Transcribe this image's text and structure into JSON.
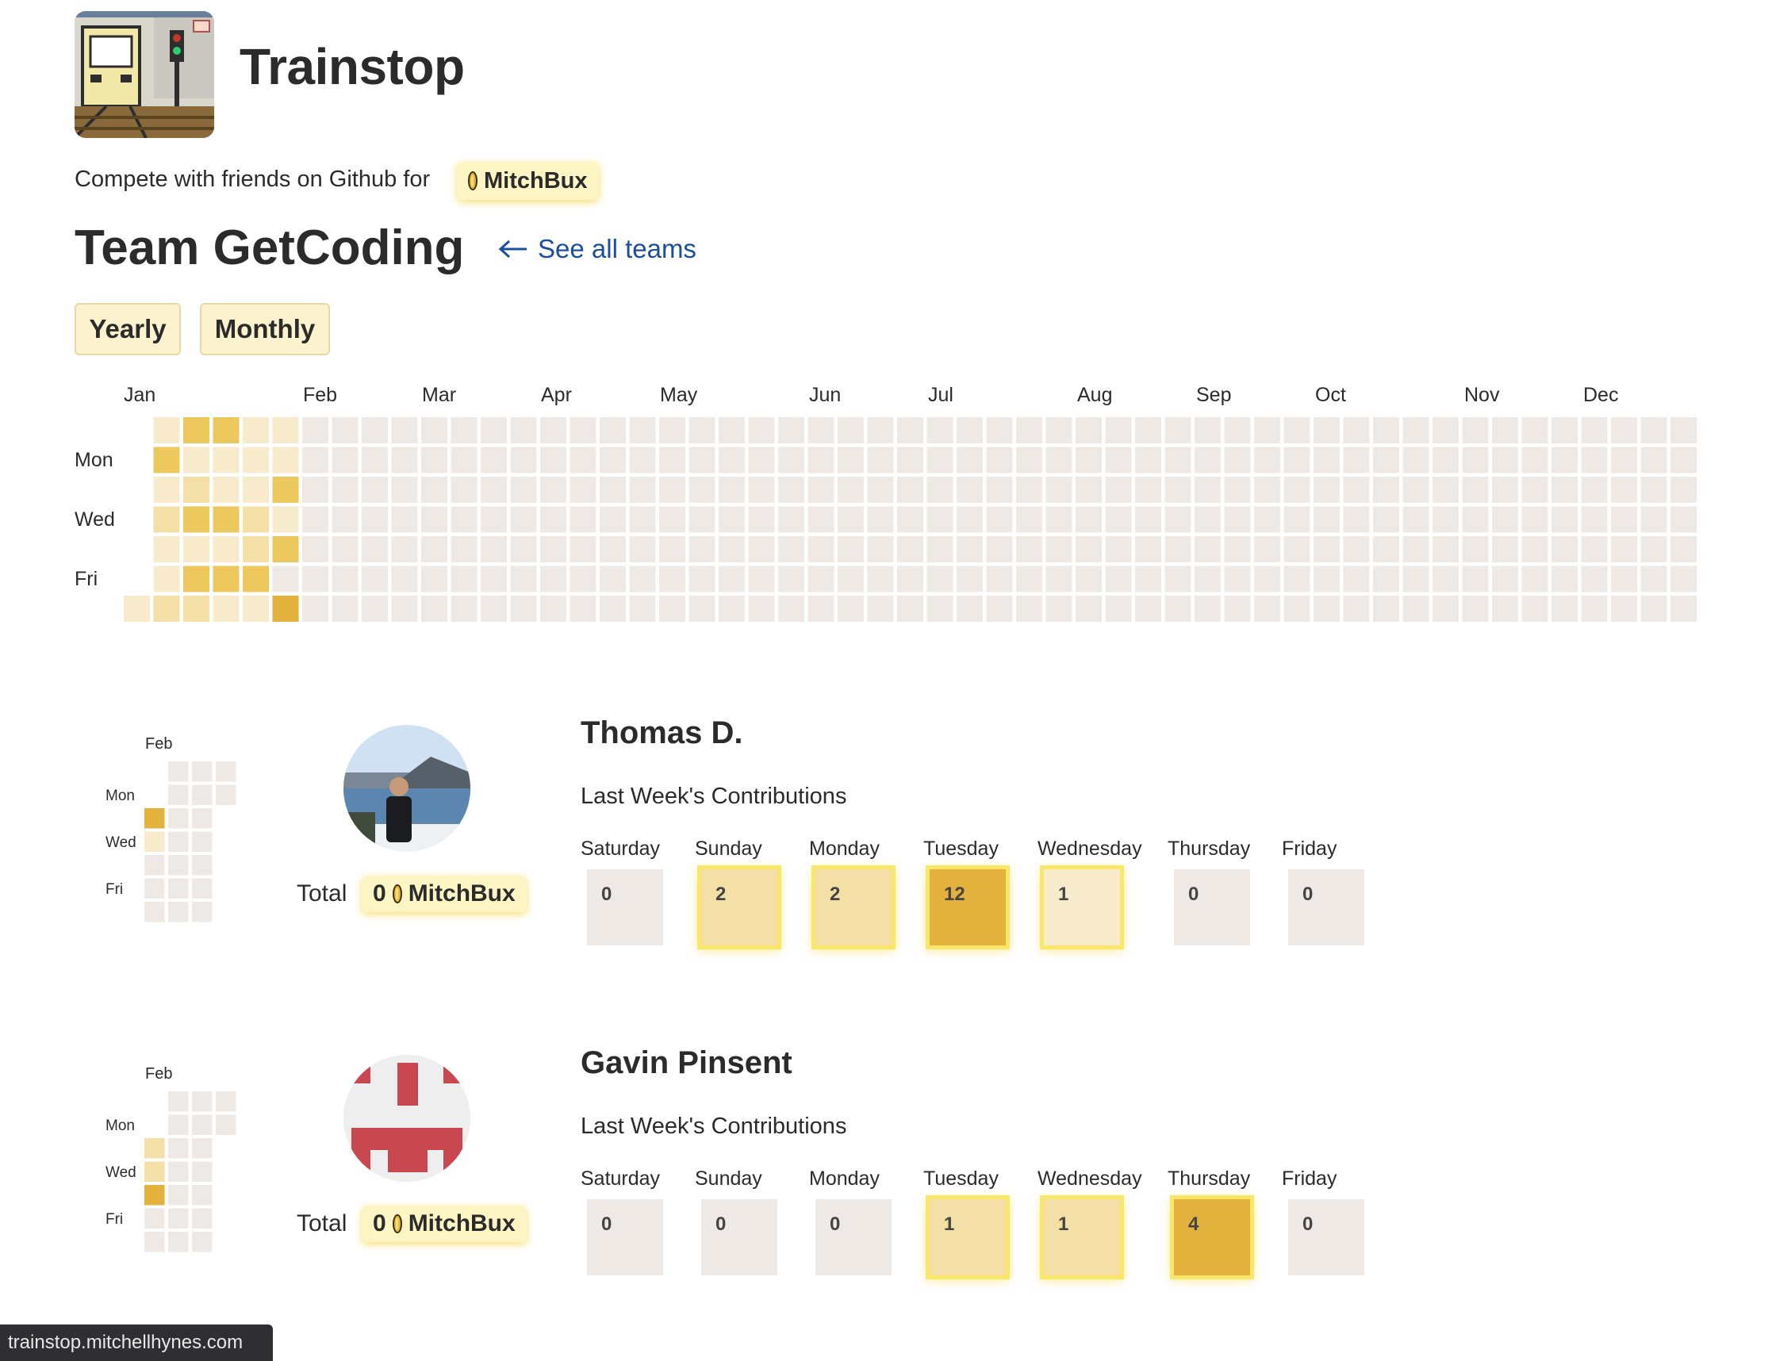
{
  "app": {
    "title": "Trainstop",
    "tagline": "Compete with friends on Github for",
    "currency": "MitchBux",
    "logo_icon": "train-station-pixel-logo"
  },
  "team": {
    "title": "Team GetCoding",
    "see_all_label": "See all teams",
    "see_all_icon": "arrow-left-icon"
  },
  "view_toggle": {
    "yearly_label": "Yearly",
    "monthly_label": "Monthly"
  },
  "heatmap": {
    "months": [
      "Jan",
      "Feb",
      "Mar",
      "Apr",
      "May",
      "Jun",
      "Jul",
      "Aug",
      "Sep",
      "Oct",
      "Nov",
      "Dec"
    ],
    "day_labels": [
      "Mon",
      "Wed",
      "Fri"
    ],
    "weeks": 53,
    "intensity_levels": {
      "0": "#efe9e6",
      "1": "#f8ebcb",
      "2": "#f4dfa7",
      "3": "#ecc85d",
      "4": "#e3b23c"
    },
    "active_weeks": [
      [
        0,
        0,
        0,
        0,
        0,
        0,
        1
      ],
      [
        1,
        3,
        1,
        2,
        1,
        1,
        2
      ],
      [
        3,
        1,
        2,
        3,
        1,
        3,
        2
      ],
      [
        3,
        1,
        1,
        3,
        1,
        3,
        1
      ],
      [
        1,
        1,
        1,
        2,
        2,
        3,
        1
      ],
      [
        1,
        1,
        3,
        1,
        3,
        0,
        4
      ]
    ]
  },
  "members": [
    {
      "name": "Thomas D.",
      "contrib_label": "Last Week's Contributions",
      "total_label": "Total",
      "total_value": "0",
      "currency": "MitchBux",
      "avatar_icon": "photo-avatar",
      "mini_month": "Feb",
      "mini_days": [
        "Mon",
        "Wed",
        "Fri"
      ],
      "mini_grid": [
        [
          0,
          0,
          4,
          1,
          0,
          0,
          0
        ],
        [
          0,
          0,
          0,
          0,
          0,
          0,
          0
        ],
        [
          0,
          0,
          0,
          0,
          0,
          0,
          0
        ],
        [
          0,
          0,
          0,
          0,
          0,
          0,
          0
        ]
      ],
      "days": [
        {
          "day": "Saturday",
          "value": "0",
          "level": 0
        },
        {
          "day": "Sunday",
          "value": "2",
          "level": 2
        },
        {
          "day": "Monday",
          "value": "2",
          "level": 2
        },
        {
          "day": "Tuesday",
          "value": "12",
          "level": 4
        },
        {
          "day": "Wednesday",
          "value": "1",
          "level": 1
        },
        {
          "day": "Thursday",
          "value": "0",
          "level": 0
        },
        {
          "day": "Friday",
          "value": "0",
          "level": 0
        }
      ]
    },
    {
      "name": "Gavin Pinsent",
      "contrib_label": "Last Week's Contributions",
      "total_label": "Total",
      "total_value": "0",
      "currency": "MitchBux",
      "avatar_icon": "identicon-avatar",
      "mini_month": "Feb",
      "mini_days": [
        "Mon",
        "Wed",
        "Fri"
      ],
      "mini_grid": [
        [
          0,
          0,
          2,
          2,
          4,
          0,
          0
        ],
        [
          0,
          0,
          0,
          0,
          0,
          0,
          0
        ],
        [
          0,
          0,
          0,
          0,
          0,
          0,
          0
        ],
        [
          0,
          0,
          0,
          0,
          0,
          0,
          0
        ]
      ],
      "days": [
        {
          "day": "Saturday",
          "value": "0",
          "level": 0
        },
        {
          "day": "Sunday",
          "value": "0",
          "level": 0
        },
        {
          "day": "Monday",
          "value": "0",
          "level": 0
        },
        {
          "day": "Tuesday",
          "value": "1",
          "level": 2
        },
        {
          "day": "Wednesday",
          "value": "1",
          "level": 2
        },
        {
          "day": "Thursday",
          "value": "4",
          "level": 4
        },
        {
          "day": "Friday",
          "value": "0",
          "level": 0
        }
      ]
    }
  ],
  "status_bar": {
    "url": "trainstop.mitchellhynes.com"
  }
}
